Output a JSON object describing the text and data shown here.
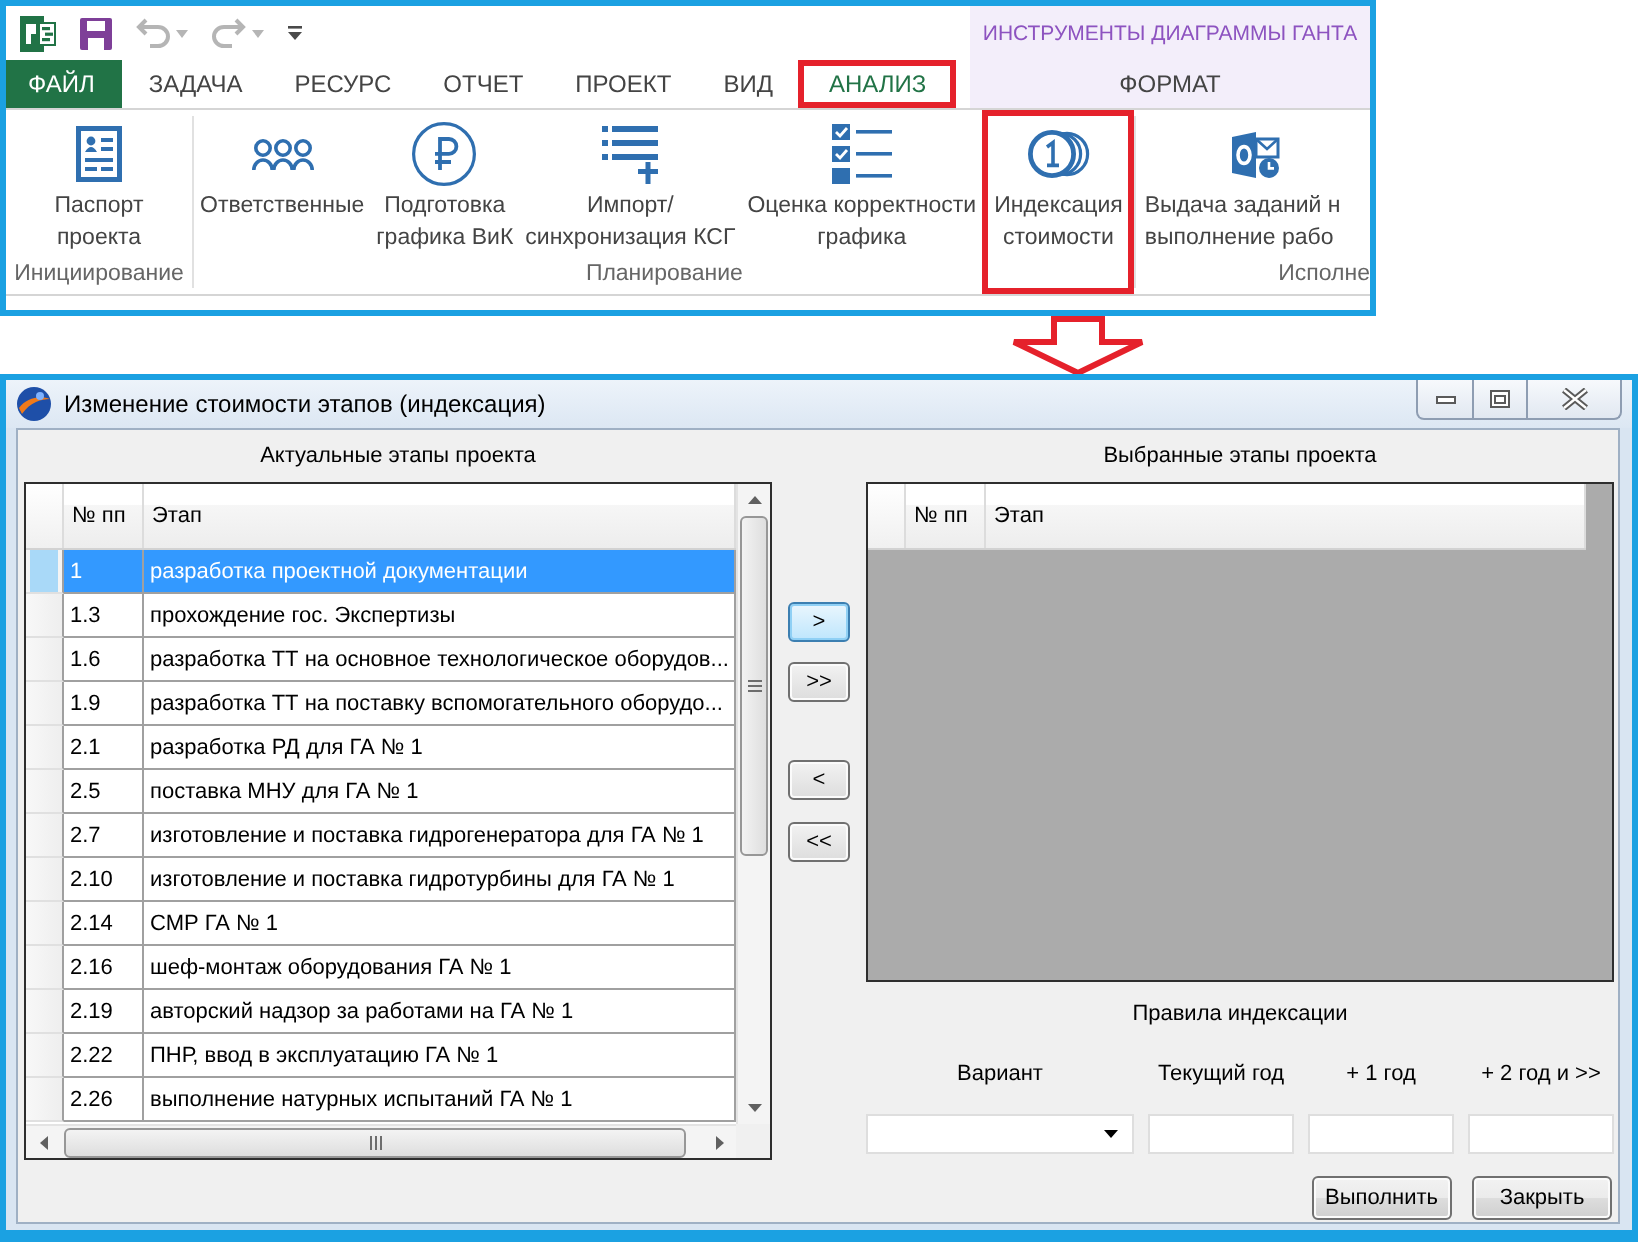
{
  "ribbon": {
    "quick_access": [
      {
        "kind": "app",
        "disabled": false
      },
      {
        "kind": "save",
        "disabled": false
      },
      {
        "kind": "undo",
        "disabled": true
      },
      {
        "kind": "redo",
        "disabled": true
      },
      {
        "kind": "customize",
        "disabled": false
      }
    ],
    "contextual_header": "ИНСТРУМЕНТЫ ДИАГРАММЫ ГАНТА",
    "tabs": [
      {
        "label": "ФАЙЛ",
        "kind": "file",
        "selected": false,
        "marked": false
      },
      {
        "label": "ЗАДАЧА",
        "kind": "tab",
        "selected": false,
        "marked": false
      },
      {
        "label": "РЕСУРС",
        "kind": "tab",
        "selected": false,
        "marked": false
      },
      {
        "label": "ОТЧЕТ",
        "kind": "tab",
        "selected": false,
        "marked": false
      },
      {
        "label": "ПРОЕКТ",
        "kind": "tab",
        "selected": false,
        "marked": false
      },
      {
        "label": "ВИД",
        "kind": "tab",
        "selected": false,
        "marked": false
      },
      {
        "label": "АНАЛИЗ",
        "kind": "tab",
        "selected": true,
        "marked": true
      },
      {
        "label": "ФОРМАТ",
        "kind": "contextual",
        "selected": false,
        "marked": false
      }
    ],
    "groups": [
      {
        "label": "Инициирование",
        "buttons": [
          {
            "kind": "passport",
            "label": "Паспорт\nпроекта",
            "marked": false
          }
        ]
      },
      {
        "label": "Планирование",
        "buttons": [
          {
            "kind": "people",
            "label": "Ответственные",
            "marked": false
          },
          {
            "kind": "ruble",
            "label": "Подготовка\nграфика ВиК",
            "marked": false
          },
          {
            "kind": "import",
            "label": "Импорт/\nсинхронизация КСГ",
            "marked": false
          },
          {
            "kind": "checklist",
            "label": "Оценка корректности\nграфика",
            "marked": false
          },
          {
            "kind": "coins",
            "label": "Индексация\nстоимости",
            "marked": true
          }
        ]
      },
      {
        "label": "Исполне",
        "buttons": [
          {
            "kind": "mail",
            "label": "Выдача заданий н\nвыполнение рабо",
            "marked": false
          }
        ]
      }
    ]
  },
  "dialog": {
    "title": "Изменение стоимости этапов (индексация)",
    "available": {
      "title": "Актуальные этапы проекта",
      "columns": [
        "№ пп",
        "Этап"
      ],
      "rows": [
        {
          "number": "1",
          "stage": "разработка проектной документации",
          "selected": true
        },
        {
          "number": "1.3",
          "stage": "прохождение гос. Экспертизы",
          "selected": false
        },
        {
          "number": "1.6",
          "stage": "разработка ТТ на основное технологическое оборудов...",
          "selected": false
        },
        {
          "number": "1.9",
          "stage": "разработка ТТ на поставку вспомогательного оборудо...",
          "selected": false
        },
        {
          "number": "2.1",
          "stage": "разработка РД для ГА № 1",
          "selected": false
        },
        {
          "number": "2.5",
          "stage": "поставка МНУ для ГА № 1",
          "selected": false
        },
        {
          "number": "2.7",
          "stage": "изготовление и поставка гидрогенератора для ГА № 1",
          "selected": false
        },
        {
          "number": "2.10",
          "stage": "изготовление и поставка гидротурбины для ГА № 1",
          "selected": false
        },
        {
          "number": "2.14",
          "stage": "СМР ГА № 1",
          "selected": false
        },
        {
          "number": "2.16",
          "stage": "шеф-монтаж оборудования ГА № 1",
          "selected": false
        },
        {
          "number": "2.19",
          "stage": "авторский надзор за работами на ГА № 1",
          "selected": false
        },
        {
          "number": "2.22",
          "stage": "ПНР, ввод в эксплуатацию ГА № 1",
          "selected": false
        },
        {
          "number": "2.26",
          "stage": "выполнение натурных испытаний ГА № 1",
          "selected": false
        }
      ]
    },
    "transfer_buttons": [
      {
        "label": ">",
        "focused": true
      },
      {
        "label": ">>",
        "focused": false
      },
      {
        "label": "<",
        "focused": false
      },
      {
        "label": "<<",
        "focused": false
      }
    ],
    "chosen": {
      "title": "Выбранные этапы проекта",
      "columns": [
        "№ пп",
        "Этап"
      ]
    },
    "indexing_rules": {
      "title": "Правила индексации",
      "fields": [
        {
          "label": "Вариант",
          "kind": "dropdown"
        },
        {
          "label": "Текущий год",
          "kind": "text"
        },
        {
          "label": "+ 1 год",
          "kind": "text"
        },
        {
          "label": "+ 2 год и >>",
          "kind": "text"
        }
      ]
    },
    "buttons": [
      "Выполнить",
      "Закрыть"
    ]
  }
}
